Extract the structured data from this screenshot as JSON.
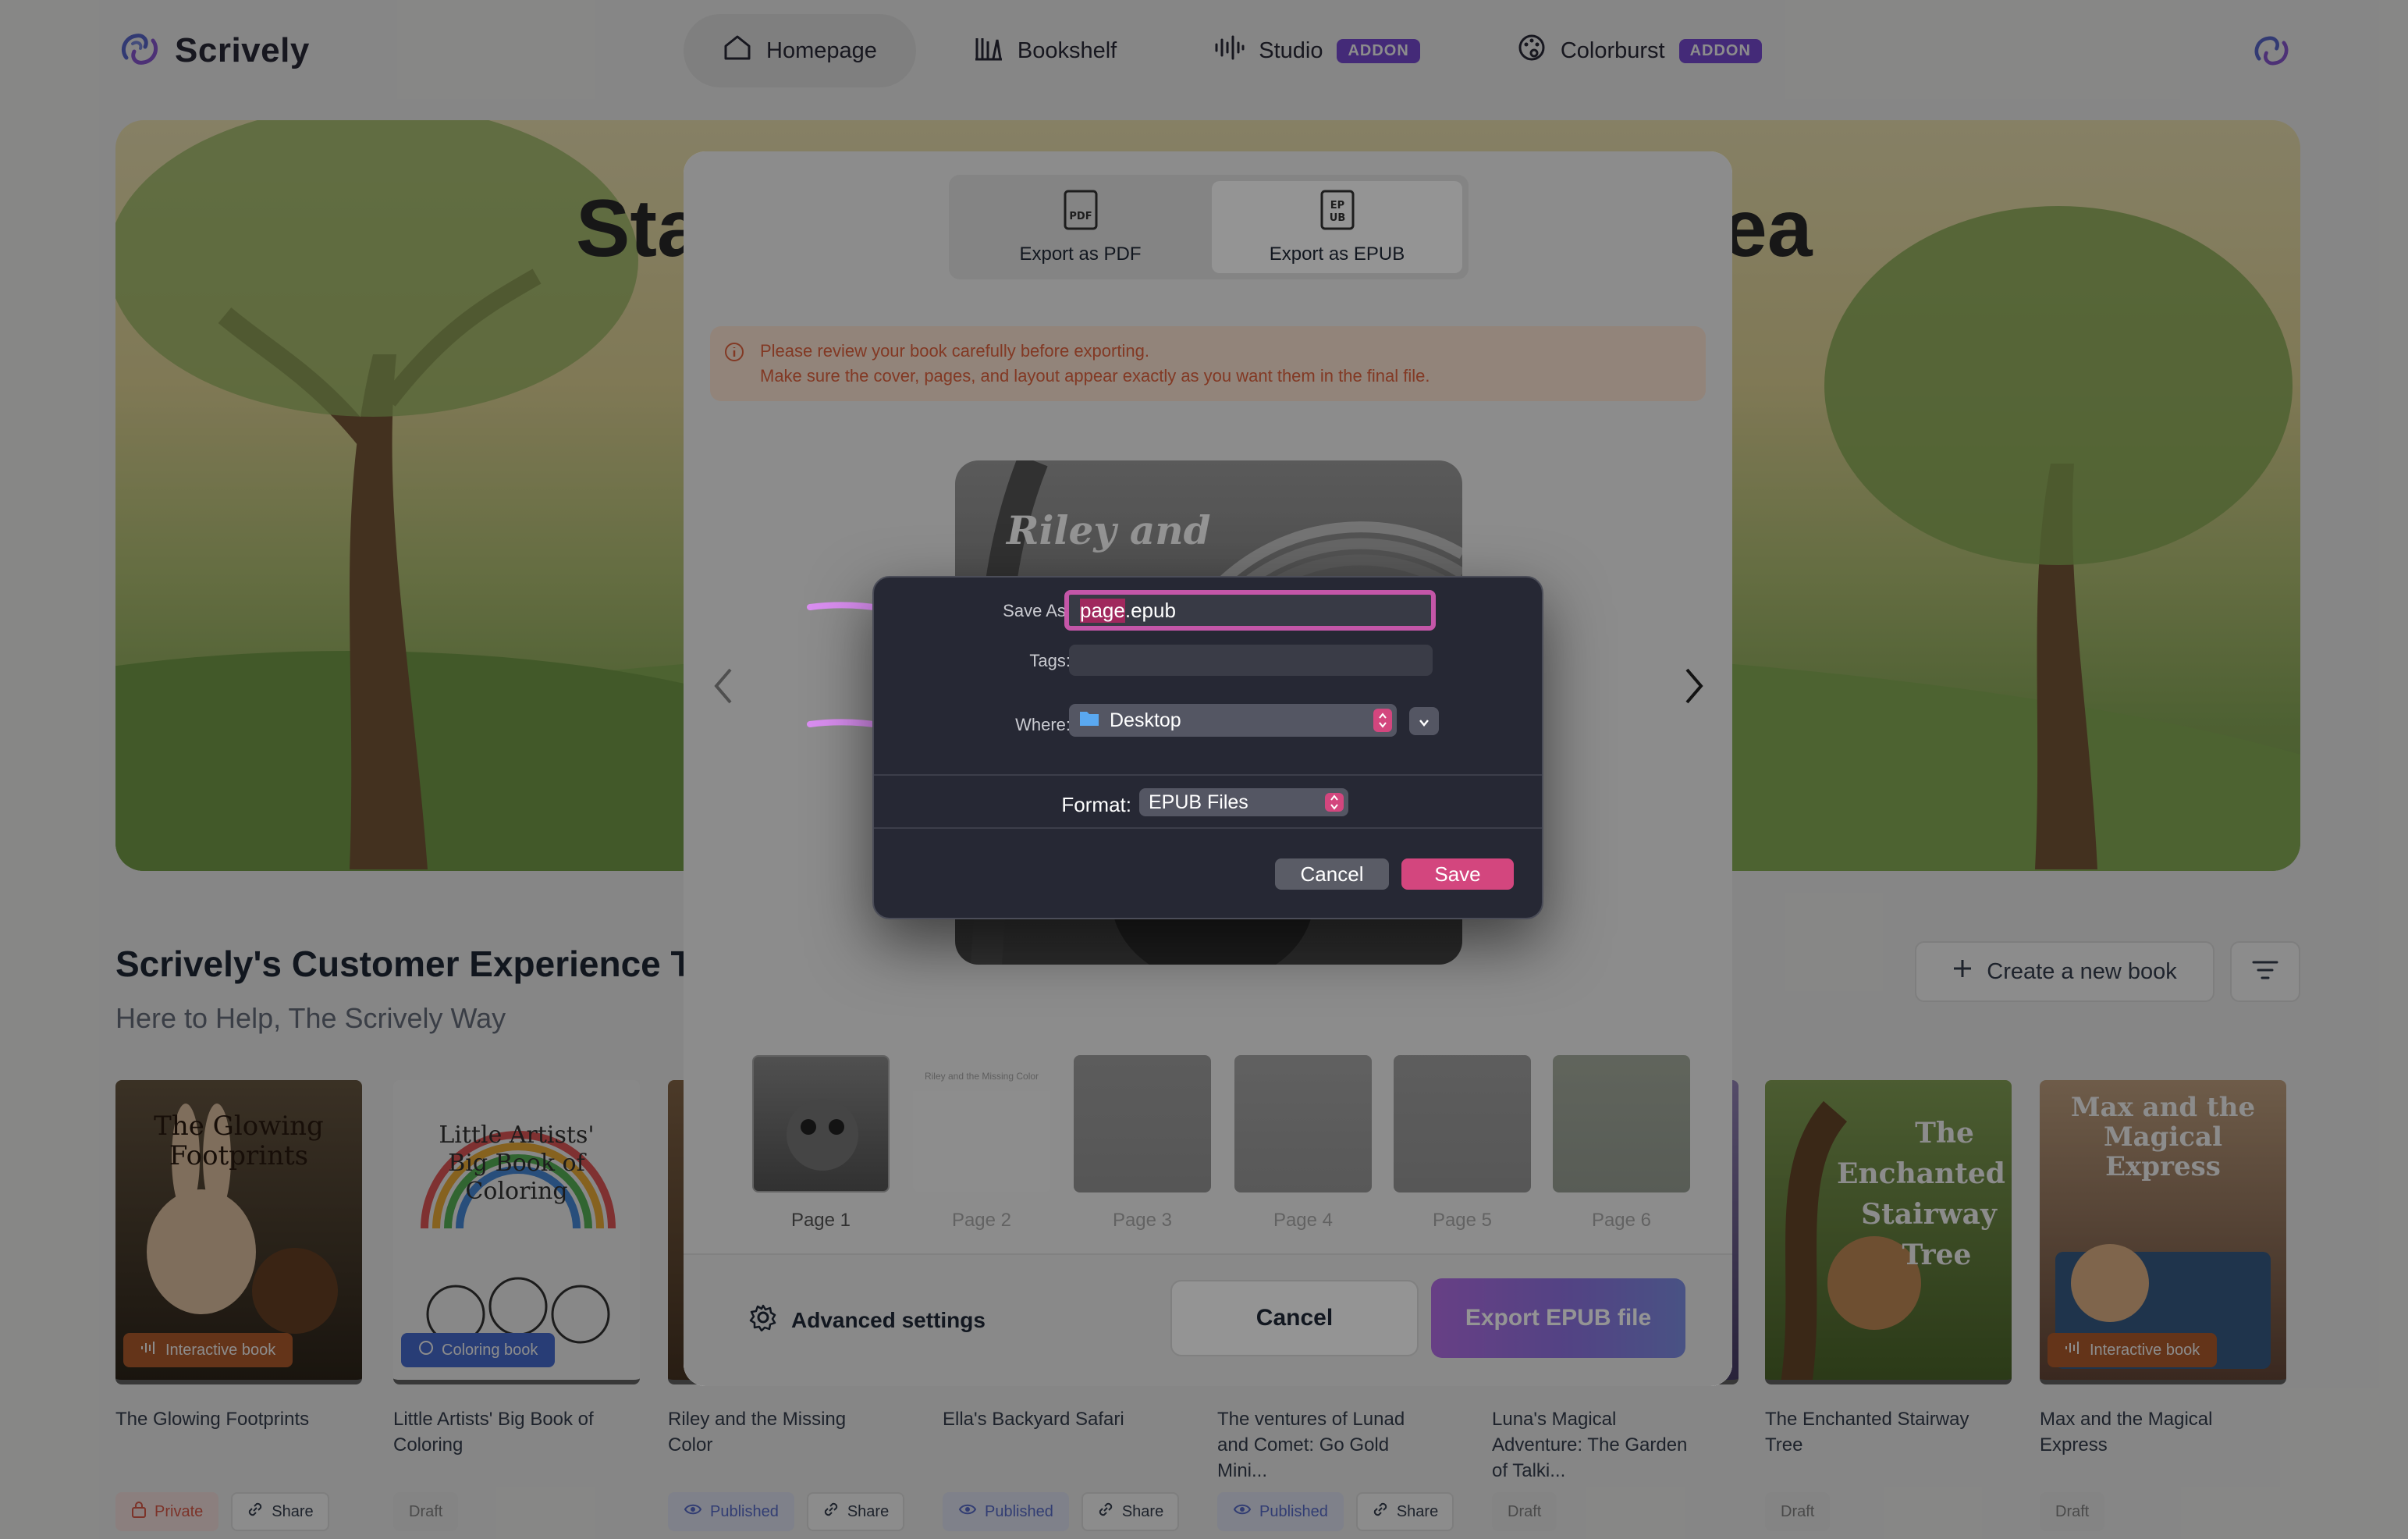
{
  "nav": {
    "brand": "Scrively",
    "items": [
      {
        "label": "Homepage",
        "active": true
      },
      {
        "label": "Bookshelf",
        "active": false
      },
      {
        "label": "Studio",
        "badge": "ADDON"
      },
      {
        "label": "Colorburst",
        "badge": "ADDON"
      }
    ]
  },
  "hero": {
    "title_left": "Sta",
    "title_right": "lea"
  },
  "section": {
    "title": "Scrively's Customer Experience T",
    "subtitle": "Here to Help, The Scrively Way",
    "create_label": "Create a new book"
  },
  "books": [
    {
      "title_line1": "The Glowing Footprints",
      "title_line2": "",
      "title_line3": "",
      "badge": "Interactive book",
      "tags": [
        "Private",
        "Share"
      ],
      "color": "#3c3124"
    },
    {
      "title_line1": "Little Artists' Big Book of",
      "title_line2": "Coloring",
      "title_line3": "",
      "badge": "Coloring book",
      "tags": [
        "Draft"
      ],
      "color": "#f3f3f3"
    },
    {
      "title_line1": "Riley and the Missing",
      "title_line2": "Color",
      "title_line3": "",
      "badge": "",
      "tags": [
        "Published",
        "Share"
      ],
      "color": "#6f5a46"
    },
    {
      "title_line1": "Ella's Backyard Safari",
      "title_line2": "",
      "title_line3": "",
      "badge": "",
      "tags": [
        "Published",
        "Share"
      ],
      "color": "#6a8a4a"
    },
    {
      "title_line1": "The ventures of Lunad",
      "title_line2": "and Comet: Go Gold",
      "title_line3": "Mini...",
      "badge": "",
      "tags": [
        "Published",
        "Share"
      ],
      "color": "#4a5f7a"
    },
    {
      "title_line1": "Luna's Magical",
      "title_line2": "Adventure: The Garden",
      "title_line3": "of Talki...",
      "badge": "",
      "tags": [
        "Draft"
      ],
      "color": "#7a6a9a"
    },
    {
      "title_line1": "The Enchanted Stairway",
      "title_line2": "Tree",
      "title_line3": "",
      "badge": "",
      "tags": [
        "Draft"
      ],
      "color": "#6b8a3c",
      "cover_text": "The Enchanted Stairway Tree"
    },
    {
      "title_line1": "Max and the Magical",
      "title_line2": "Express",
      "title_line3": "",
      "badge": "Interactive book",
      "tags": [
        "Draft"
      ],
      "color": "#a9896a",
      "cover_text": "Max and the Magical Express"
    }
  ],
  "modal": {
    "tab_pdf": "Export as PDF",
    "tab_epub": "Export as EPUB",
    "notice_line1": "Please review your book carefully before exporting.",
    "notice_line2": "Make sure the cover, pages, and layout appear exactly as you want them in the final file.",
    "preview_title": "Riley and",
    "thumb_caption": "Riley and the Missing Color",
    "pages": [
      "Page 1",
      "Page 2",
      "Page 3",
      "Page 4",
      "Page 5",
      "Page 6"
    ],
    "advanced": "Advanced settings",
    "cancel": "Cancel",
    "export": "Export EPUB file"
  },
  "save_dialog": {
    "save_as_label": "Save As:",
    "filename_selected": "page",
    "filename_ext": ".epub",
    "tags_label": "Tags:",
    "where_label": "Where:",
    "where_value": "Desktop",
    "format_label": "Format:",
    "format_value": "EPUB Files",
    "cancel": "Cancel",
    "save": "Save"
  },
  "colors": {
    "accent": "#d3467e",
    "brand": "#7c4ddb",
    "arrow": "#d98ef0"
  }
}
